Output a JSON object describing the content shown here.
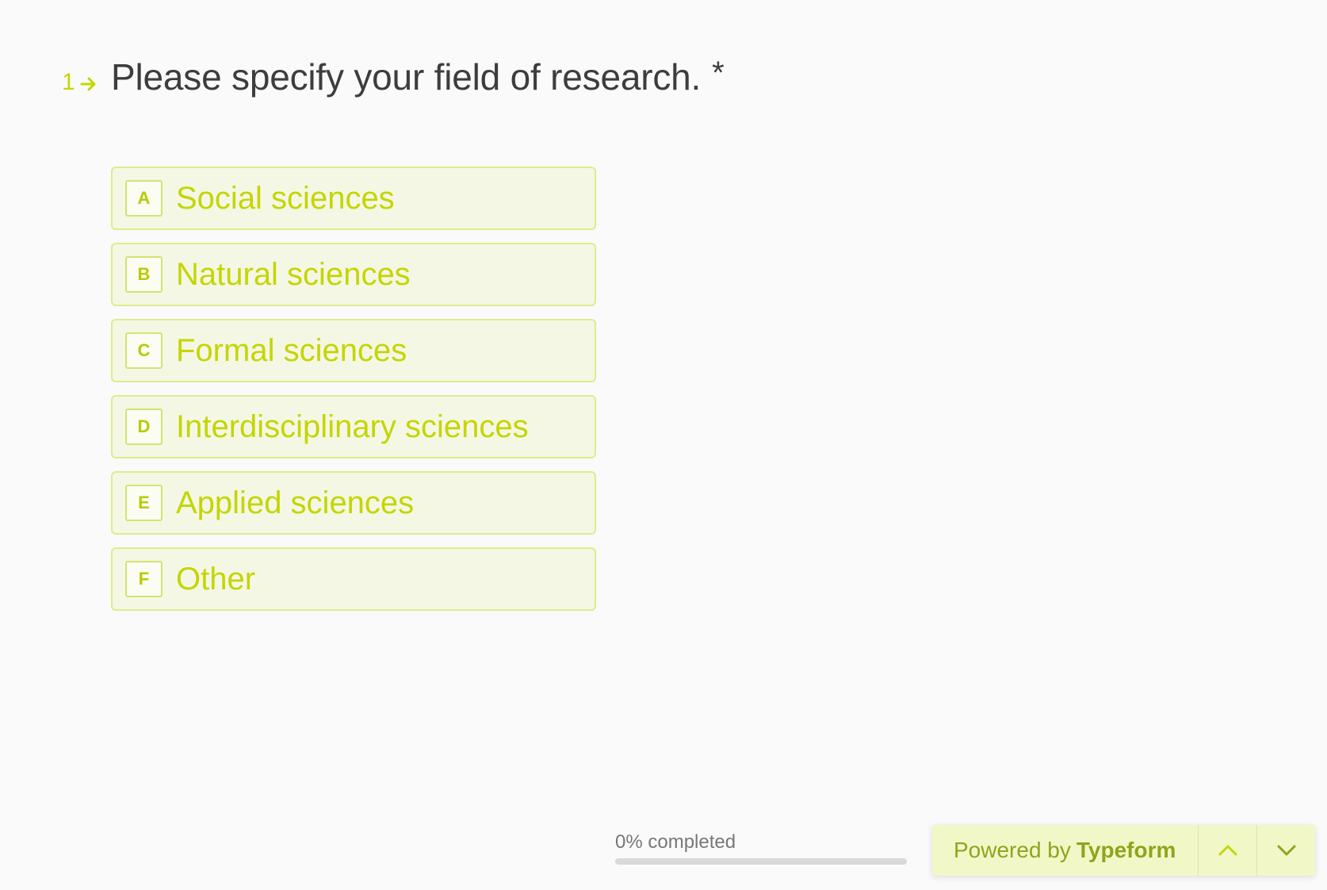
{
  "question": {
    "number": "1",
    "text": "Please specify your field of research.",
    "required_marker": "*"
  },
  "choices": [
    {
      "key": "A",
      "label": "Social sciences"
    },
    {
      "key": "B",
      "label": "Natural sciences"
    },
    {
      "key": "C",
      "label": "Formal sciences"
    },
    {
      "key": "D",
      "label": "Interdisciplinary sciences"
    },
    {
      "key": "E",
      "label": "Applied sciences"
    },
    {
      "key": "F",
      "label": "Other"
    }
  ],
  "progress": {
    "label": "0% completed",
    "percent": 0
  },
  "footer": {
    "powered_by": "Powered by",
    "brand": "Typeform",
    "up_icon": "chevron-up-icon",
    "down_icon": "chevron-down-icon"
  },
  "colors": {
    "accent": "#c4d600",
    "question_text": "#3d3d3d",
    "choice_bg": "#f5f7e5",
    "choice_border": "#e1ea8c",
    "footer_bg": "#f2f7c8"
  }
}
